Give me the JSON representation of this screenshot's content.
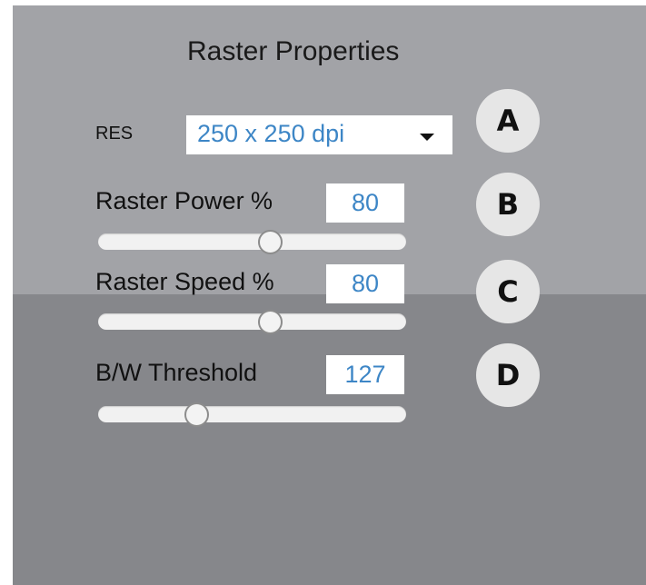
{
  "panel": {
    "title": "Raster Properties"
  },
  "resolution": {
    "label": "RES",
    "value": "250 x 250 dpi",
    "badge": "A"
  },
  "raster_power": {
    "label": "Raster Power %",
    "value": "80",
    "badge": "B",
    "slider_fraction": 0.56
  },
  "raster_speed": {
    "label": "Raster Speed %",
    "value": "80",
    "badge": "C",
    "slider_fraction": 0.56
  },
  "bw_threshold": {
    "label": "B/W Threshold",
    "value": "127",
    "badge": "D",
    "slider_fraction": 0.32
  },
  "icons": {
    "dropdown": "chevron-down-icon"
  },
  "colors": {
    "panel_light": "#a2a3a7",
    "panel_dark": "#86878b",
    "value_text": "#3d86c6",
    "badge_bg": "#e6e6e6"
  }
}
